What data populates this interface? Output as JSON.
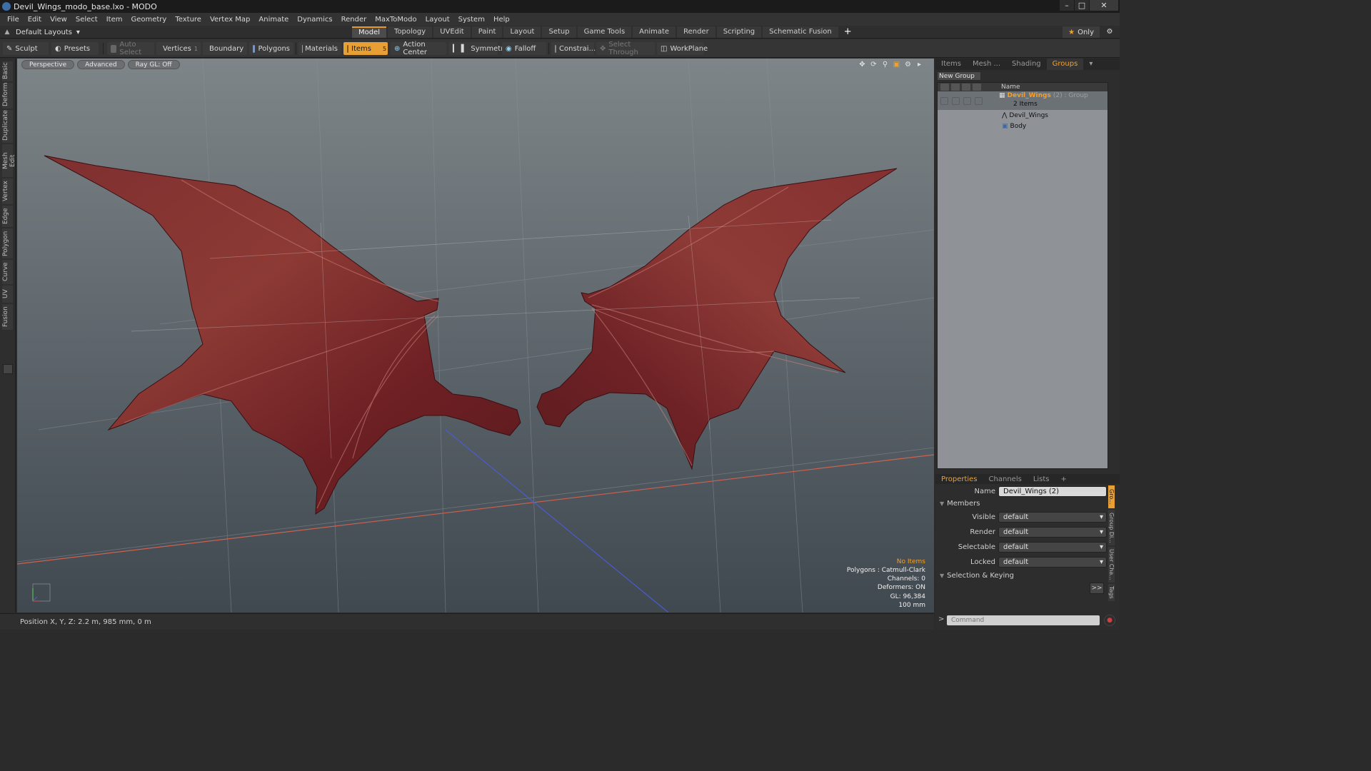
{
  "window": {
    "title": "Devil_Wings_modo_base.lxo - MODO"
  },
  "menu": [
    "File",
    "Edit",
    "View",
    "Select",
    "Item",
    "Geometry",
    "Texture",
    "Vertex Map",
    "Animate",
    "Dynamics",
    "Render",
    "MaxToModo",
    "Layout",
    "System",
    "Help"
  ],
  "layout": {
    "selector": "Default Layouts",
    "tabs": [
      "Model",
      "Topology",
      "UVEdit",
      "Paint",
      "Layout",
      "Setup",
      "Game Tools",
      "Animate",
      "Render",
      "Scripting",
      "Schematic Fusion"
    ],
    "active_tab": "Model",
    "only_label": "Only"
  },
  "toolbar": {
    "sculpt": "Sculpt",
    "presets": "Presets",
    "auto_select": "Auto Select",
    "vertices": "Vertices",
    "vertices_count": "1",
    "boundary": "Boundary",
    "polygons": "Polygons",
    "materials": "Materials",
    "items": "Items",
    "items_count": "5",
    "action_center": "Action Center",
    "symmetry": "Symmetry",
    "falloff": "Falloff",
    "constraints": "Constrai...",
    "select_through": "Select Through",
    "workplane": "WorkPlane"
  },
  "left_tabs": [
    "Basic",
    "Deform",
    "Duplicate",
    "Mesh Edit",
    "Vertex",
    "Edge",
    "Polygon",
    "Curve",
    "UV",
    "Fusion"
  ],
  "viewport": {
    "view": "Perspective",
    "shading": "Advanced",
    "raygl": "Ray GL: Off",
    "info": {
      "selection": "No Items",
      "polygons": "Polygons : Catmull-Clark",
      "channels": "Channels: 0",
      "deformers": "Deformers: ON",
      "gl": "GL: 96,384",
      "grid": "100 mm"
    }
  },
  "status": {
    "position": "Position X, Y, Z:   2.2 m, 985 mm, 0 m"
  },
  "right_panel": {
    "tabs": [
      "Items",
      "Mesh ...",
      "Shading",
      "Groups"
    ],
    "active_tab": "Groups",
    "new_group": "New Group",
    "list_header": "Name",
    "groups": {
      "group_name": "Devil_Wings",
      "group_suffix": "(2) : Group",
      "items_count": "2 Items",
      "children": [
        "Devil_Wings",
        "Body"
      ]
    },
    "props_tabs": [
      "Properties",
      "Channels",
      "Lists"
    ],
    "props_active": "Properties",
    "props": {
      "name_label": "Name",
      "name_value": "Devil_Wings (2)",
      "members_section": "Members",
      "visible_label": "Visible",
      "visible_value": "default",
      "render_label": "Render",
      "render_value": "default",
      "selectable_label": "Selectable",
      "selectable_value": "default",
      "locked_label": "Locked",
      "locked_value": "default",
      "selection_section": "Selection & Keying"
    },
    "side_tabs": [
      "Gro...",
      "Group Di...",
      "User Cha...",
      "Tags"
    ],
    "command_placeholder": "Command"
  },
  "colors": {
    "accent": "#e8a035",
    "wing_red": "#8f2a2c",
    "axis_red": "#d0604f",
    "axis_blue": "#4b5bd0"
  }
}
